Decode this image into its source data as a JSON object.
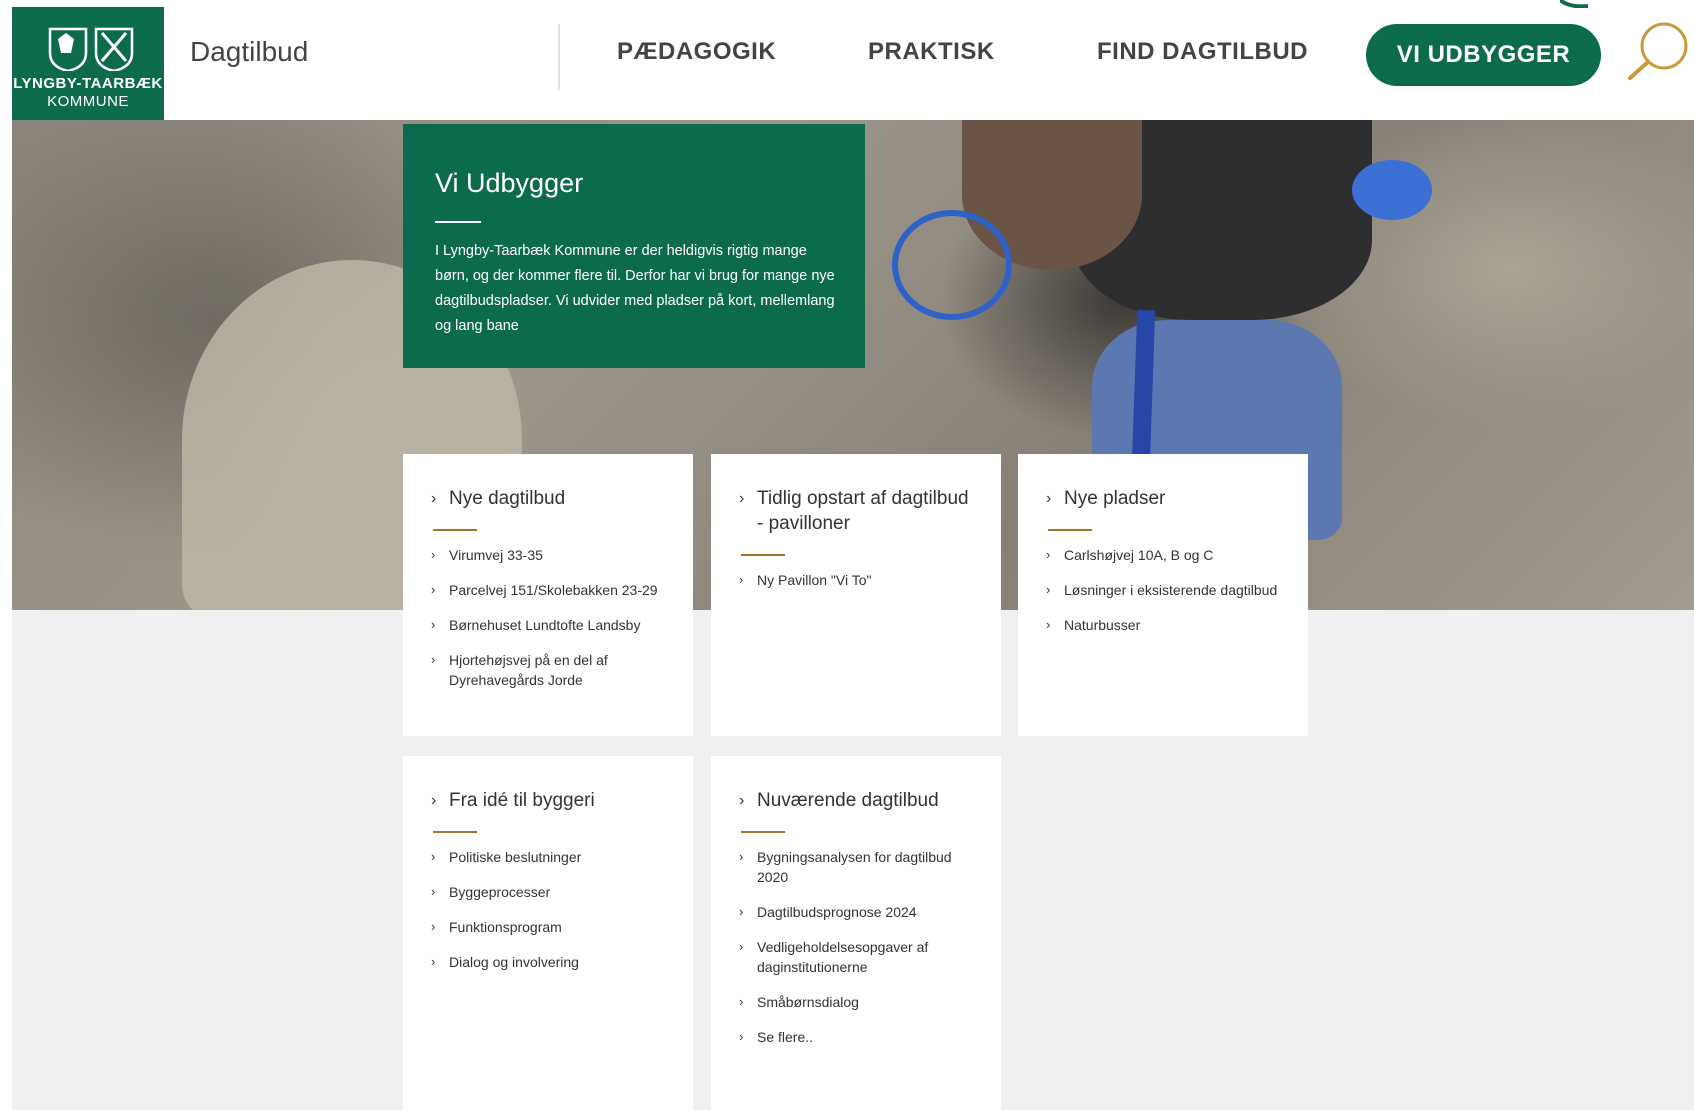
{
  "header": {
    "logo_line1": "LYNGBY-TAARBÆK",
    "logo_line2": "KOMMUNE",
    "site_title": "Dagtilbud",
    "nav": [
      {
        "label": "PÆDAGOGIK"
      },
      {
        "label": "PRAKTISK"
      },
      {
        "label": "FIND DAGTILBUD"
      }
    ],
    "cta_label": "VI UDBYGGER",
    "colors": {
      "brand_green": "#0d6b4d",
      "search_gold": "#c79a3a",
      "accent_gold": "#a0762a"
    }
  },
  "intro": {
    "title": "Vi Udbygger",
    "text": "I Lyngby-Taarbæk Kommune er der heldigvis rigtig mange børn, og der kommer flere til. Derfor har vi brug for mange nye dagtilbudspladser. Vi udvider med pladser på kort, mellemlang og lang bane"
  },
  "cards": [
    {
      "title": "Nye dagtilbud",
      "links": [
        "Virumvej 33-35",
        "Parcelvej 151/Skolebakken 23-29",
        "Børnehuset Lundtofte Landsby",
        "Hjortehøjsvej på en del af Dyrehavegårds Jorde"
      ]
    },
    {
      "title": "Tidlig opstart af dagtilbud - pavilloner",
      "links": [
        "Ny Pavillon \"Vi To\""
      ]
    },
    {
      "title": "Nye pladser",
      "links": [
        "Carlshøjvej 10A, B og C",
        "Løsninger i eksisterende dagtilbud",
        "Naturbusser"
      ]
    },
    {
      "title": "Fra idé til byggeri",
      "links": [
        "Politiske beslutninger",
        "Byggeprocesser",
        "Funktionsprogram",
        "Dialog og involvering"
      ]
    },
    {
      "title": "Nuværende dagtilbud",
      "links": [
        "Bygningsanalysen for dagtilbud 2020",
        "Dagtilbudsprognose 2024",
        "Vedligeholdelsesopgaver af daginstitutionerne",
        "Småbørnsdialog",
        "Se flere.."
      ]
    }
  ]
}
